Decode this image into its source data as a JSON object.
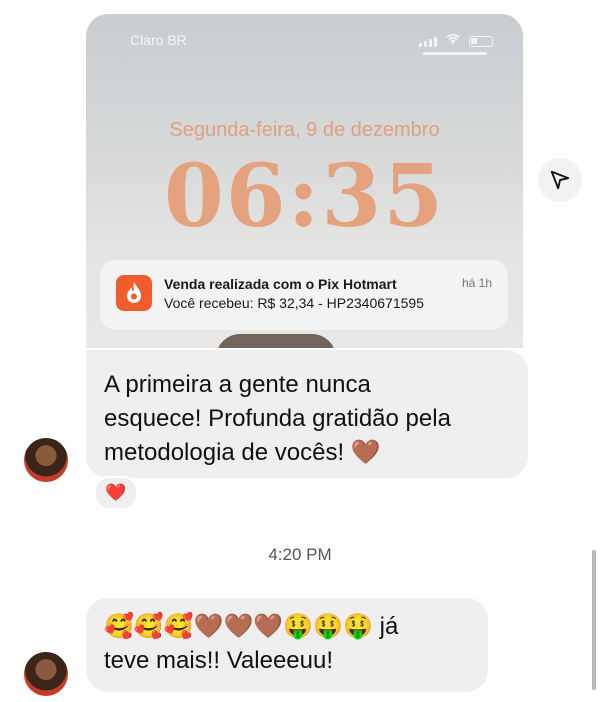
{
  "screenshot": {
    "carrier": "Claro BR",
    "date": "Segunda-feira, 9 de dezembro",
    "time": "06:35",
    "notification": {
      "title": "Venda realizada com o Pix Hotmart",
      "time": "há 1h",
      "body": "Você recebeu: R$ 32,34 - HP2340671595",
      "app_icon": "hotmart-flame-icon",
      "app_color": "#f05c2b"
    }
  },
  "messages": [
    {
      "line1": "A primeira a gente nunca",
      "line2": "esquece! Profunda gratidão pela",
      "line3": "metodologia de vocês! 🤎",
      "reaction": "❤️"
    },
    {
      "line1": "🥰🥰🥰🤎🤎🤎🤑🤑🤑 já",
      "line2": "teve mais!! Valeeeuu!"
    }
  ],
  "timestamp": "4:20 PM",
  "icons": {
    "share": "send-icon",
    "avatar": "avatar"
  },
  "colors": {
    "bubble": "#efefef",
    "lock_text": "#e4a27e",
    "reaction": "#e01a1a"
  }
}
